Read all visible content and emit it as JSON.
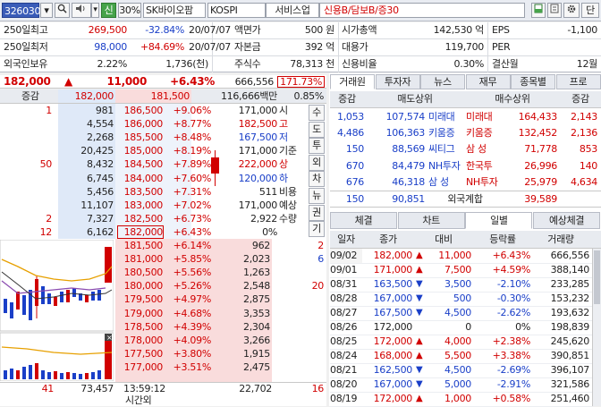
{
  "toolbar": {
    "code": "326030",
    "name": "SK바이오팜",
    "market": "KOSPI",
    "sector": "서비스업",
    "margin": "신용B/담보B/증30",
    "shin": "신",
    "pct30": "30%",
    "danil": "단"
  },
  "info": {
    "r1": {
      "l1": "250일최고",
      "v1": "269,500",
      "p1": "-32.84%",
      "d1": "20/07/07",
      "l2": "액면가",
      "v2": "500 원",
      "l3": "시가총액",
      "v3": "142,530 억",
      "l4": "EPS",
      "v4": "-1,100"
    },
    "r2": {
      "l1": "250일최저",
      "v1": "98,000",
      "p1": "+84.69%",
      "d1": "20/07/07",
      "l2": "자본금",
      "v2": "392 억",
      "l3": "대용가",
      "v3": "119,700",
      "l4": "PER",
      "v4": ""
    },
    "r3": {
      "l1": "외국인보유",
      "v1": "2.22%",
      "v1b": "1,736(천)",
      "l2": "주식수",
      "v2": "78,313 천",
      "l3": "신용비율",
      "v3": "0.30%",
      "l4": "결산월",
      "v4": "12월"
    }
  },
  "price": {
    "cur": "182,000",
    "chg": "11,000",
    "pct": "+6.43%",
    "vol": "666,556",
    "ratio": "171.73%"
  },
  "ob_header": {
    "label": "증감",
    "ask_total": "182,000",
    "bid_total": "181,500",
    "amt": "116,666백만",
    "pct": "0.85%"
  },
  "asks": [
    {
      "qty": "981",
      "price": "186,500",
      "pct": "+9.06%",
      "delta": "1"
    },
    {
      "qty": "4,554",
      "price": "186,000",
      "pct": "+8.77%",
      "delta": ""
    },
    {
      "qty": "2,268",
      "price": "185,500",
      "pct": "+8.48%",
      "delta": ""
    },
    {
      "qty": "20,425",
      "price": "185,000",
      "pct": "+8.19%",
      "delta": ""
    },
    {
      "qty": "8,432",
      "price": "184,500",
      "pct": "+7.89%",
      "delta": "50"
    },
    {
      "qty": "6,745",
      "price": "184,000",
      "pct": "+7.60%",
      "delta": ""
    },
    {
      "qty": "5,456",
      "price": "183,500",
      "pct": "+7.31%",
      "delta": ""
    },
    {
      "qty": "11,107",
      "price": "183,000",
      "pct": "+7.02%",
      "delta": ""
    },
    {
      "qty": "7,327",
      "price": "182,500",
      "pct": "+6.73%",
      "delta": "2"
    },
    {
      "qty": "6,162",
      "price": "182,000",
      "pct": "+6.43%",
      "delta": "12"
    }
  ],
  "bids": [
    {
      "qty": "962",
      "price": "181,500",
      "pct": "+6.14%",
      "delta": "2"
    },
    {
      "qty": "2,023",
      "price": "181,000",
      "pct": "+5.85%",
      "delta": "6"
    },
    {
      "qty": "1,263",
      "price": "180,500",
      "pct": "+5.56%",
      "delta": ""
    },
    {
      "qty": "2,548",
      "price": "180,000",
      "pct": "+5.26%",
      "delta": "20"
    },
    {
      "qty": "2,875",
      "price": "179,500",
      "pct": "+4.97%",
      "delta": ""
    },
    {
      "qty": "3,353",
      "price": "179,000",
      "pct": "+4.68%",
      "delta": ""
    },
    {
      "qty": "2,304",
      "price": "178,500",
      "pct": "+4.39%",
      "delta": ""
    },
    {
      "qty": "3,266",
      "price": "178,000",
      "pct": "+4.09%",
      "delta": ""
    },
    {
      "qty": "1,915",
      "price": "177,500",
      "pct": "+3.80%",
      "delta": ""
    },
    {
      "qty": "2,475",
      "price": "177,000",
      "pct": "+3.51%",
      "delta": ""
    }
  ],
  "summary": [
    {
      "v": "171,000",
      "l": "시"
    },
    {
      "v": "182,500",
      "l": "고"
    },
    {
      "v": "167,500",
      "l": "저"
    },
    {
      "v": "171,000",
      "l": "기준"
    },
    {
      "v": "222,000",
      "l": "상"
    },
    {
      "v": "120,000",
      "l": "하"
    },
    {
      "v": "511",
      "l": "비용"
    },
    {
      "v": "171,000",
      "l": "예상"
    },
    {
      "v": "2,922",
      "l": "수량"
    },
    {
      "v": "0%",
      "l": ""
    }
  ],
  "side_buttons": [
    "수",
    "도",
    "투",
    "외",
    "차",
    "뉴",
    "권",
    "기"
  ],
  "footer": {
    "ask_delta": "41",
    "ask_total": "73,457",
    "time": "13:59:12",
    "time_label": "시간외",
    "bid_total": "22,702",
    "bid_delta": "16"
  },
  "broker_tabs": [
    "거래원",
    "투자자",
    "뉴스",
    "재무",
    "종목별",
    "프로"
  ],
  "broker_header": {
    "h1": "증감",
    "h2": "매도상위",
    "h3": "매수상위",
    "h4": "증감"
  },
  "brokers": [
    {
      "sd": "1,053",
      "sq": "107,574",
      "sn": "미래대",
      "bn": "미래대",
      "bq": "164,433",
      "bd": "2,143"
    },
    {
      "sd": "4,486",
      "sq": "106,363",
      "sn": "키움증",
      "bn": "키움증",
      "bq": "132,452",
      "bd": "2,136"
    },
    {
      "sd": "150",
      "sq": "88,569",
      "sn": "씨티그",
      "bn": "삼 성",
      "bq": "71,778",
      "bd": "853"
    },
    {
      "sd": "670",
      "sq": "84,479",
      "sn": "NH투자",
      "bn": "한국투",
      "bq": "26,996",
      "bd": "140"
    },
    {
      "sd": "676",
      "sq": "46,318",
      "sn": "삼 성",
      "bn": "NH투자",
      "bq": "25,979",
      "bd": "4,634"
    }
  ],
  "foreign": {
    "sd": "150",
    "sq": "90,851",
    "label": "외국계합",
    "bq": "39,589",
    "bd": ""
  },
  "lower_tabs": [
    "체결",
    "차트",
    "일별",
    "예상체결"
  ],
  "daily_header": {
    "h1": "일자",
    "h2": "종가",
    "h3": "대비",
    "h4": "등락률",
    "h5": "거래량"
  },
  "daily": [
    {
      "date": "09/02",
      "close": "182,000",
      "arrow": "▲",
      "chg": "11,000",
      "pct": "+6.43%",
      "vol": "666,556",
      "dir": "up"
    },
    {
      "date": "09/01",
      "close": "171,000",
      "arrow": "▲",
      "chg": "7,500",
      "pct": "+4.59%",
      "vol": "388,140",
      "dir": "up"
    },
    {
      "date": "08/31",
      "close": "163,500",
      "arrow": "▼",
      "chg": "3,500",
      "pct": "-2.10%",
      "vol": "233,285",
      "dir": "down"
    },
    {
      "date": "08/28",
      "close": "167,000",
      "arrow": "▼",
      "chg": "500",
      "pct": "-0.30%",
      "vol": "153,232",
      "dir": "down"
    },
    {
      "date": "08/27",
      "close": "167,500",
      "arrow": "▼",
      "chg": "4,500",
      "pct": "-2.62%",
      "vol": "193,632",
      "dir": "down"
    },
    {
      "date": "08/26",
      "close": "172,000",
      "arrow": "",
      "chg": "0",
      "pct": "0%",
      "vol": "198,839",
      "dir": "flat"
    },
    {
      "date": "08/25",
      "close": "172,000",
      "arrow": "▲",
      "chg": "4,000",
      "pct": "+2.38%",
      "vol": "245,620",
      "dir": "up"
    },
    {
      "date": "08/24",
      "close": "168,000",
      "arrow": "▲",
      "chg": "5,500",
      "pct": "+3.38%",
      "vol": "390,851",
      "dir": "up"
    },
    {
      "date": "08/21",
      "close": "162,500",
      "arrow": "▼",
      "chg": "4,500",
      "pct": "-2.69%",
      "vol": "396,107",
      "dir": "down"
    },
    {
      "date": "08/20",
      "close": "167,000",
      "arrow": "▼",
      "chg": "5,000",
      "pct": "-2.91%",
      "vol": "321,586",
      "dir": "down"
    },
    {
      "date": "08/19",
      "close": "172,000",
      "arrow": "▲",
      "chg": "1,000",
      "pct": "+0.58%",
      "vol": "251,460",
      "dir": "up"
    }
  ],
  "colors": {
    "up": "#d10000",
    "down": "#1a3fc8",
    "accent": "#3a5cb8",
    "ask_bg": "#dfe9f8",
    "bid_bg": "#f9dcdc"
  },
  "icons": [
    "search-icon",
    "speaker-icon",
    "layout-icon",
    "sheet-icon",
    "gear-icon",
    "dropdown-icon"
  ]
}
